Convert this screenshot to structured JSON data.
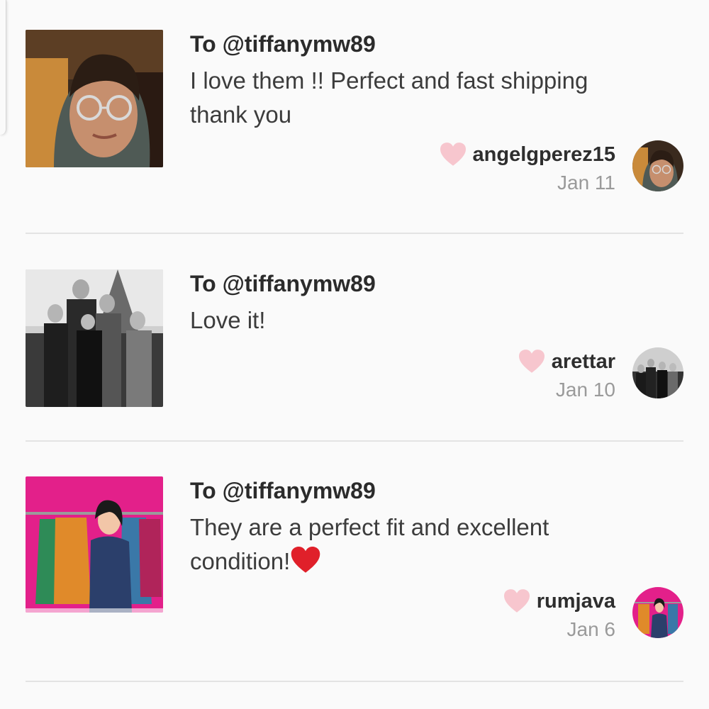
{
  "reviews": [
    {
      "to": "To @tiffanymw89",
      "comment": "I love them !! Perfect and fast shipping thank you",
      "username": "angelgperez15",
      "date": "Jan 11",
      "photo_icon": "person-glasses-hoodie-photo"
    },
    {
      "to": "To @tiffanymw89",
      "comment": "Love it!",
      "username": "arettar",
      "date": "Jan 10",
      "photo_icon": "family-bw-photo"
    },
    {
      "to": "To @tiffanymw89",
      "comment": "They are a perfect fit and excellent condition!",
      "comment_emoji": "red-heart",
      "username": "rumjava",
      "date": "Jan 6",
      "photo_icon": "closet-illustration-photo"
    }
  ],
  "colors": {
    "heart": "#f7c6ce",
    "emoji_heart": "#e0202a",
    "divider": "#e3e3e3",
    "background": "#fafafa",
    "date": "#9a9a9a"
  }
}
